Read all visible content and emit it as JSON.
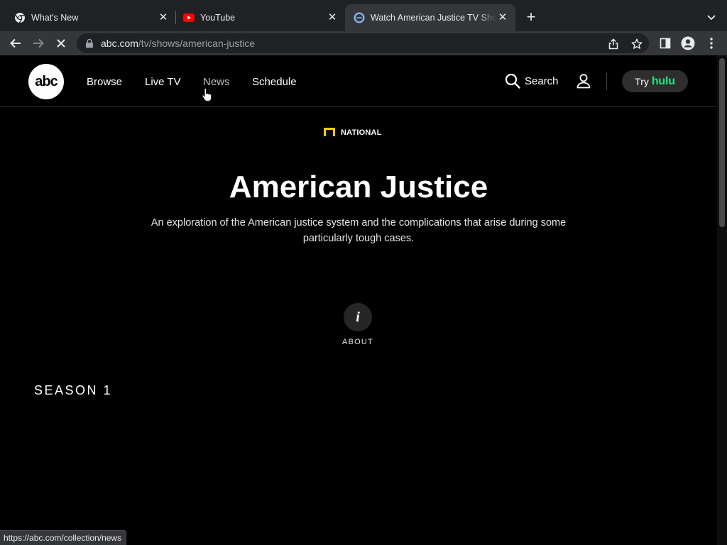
{
  "browser": {
    "tabs": [
      {
        "title": "What's New",
        "icon": "chrome-icon",
        "close": "✕"
      },
      {
        "title": "YouTube",
        "icon": "youtube-icon",
        "close": "✕"
      },
      {
        "title": "Watch American Justice TV Show",
        "icon": "abc-favicon",
        "close": "✕",
        "active": true
      }
    ],
    "new_tab": "+",
    "url_host": "abc.com",
    "url_path": "/tv/shows/american-justice",
    "status_url": "https://abc.com/collection/news"
  },
  "site": {
    "logo": "abc",
    "nav": [
      "Browse",
      "Live TV",
      "News",
      "Schedule"
    ],
    "search_label": "Search",
    "try_label": "Try",
    "hulu_label": "hulu",
    "brand_color": "#1ce783"
  },
  "show": {
    "network": "NATIONAL",
    "title": "American Justice",
    "description": "An exploration of the American justice system and the complications that arise during some particularly tough cases.",
    "about_icon": "i",
    "about_label": "ABOUT",
    "season_label": "SEASON 1"
  }
}
